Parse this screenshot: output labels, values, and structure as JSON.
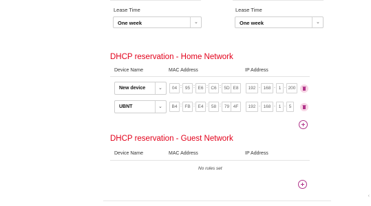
{
  "lease": {
    "left": {
      "label": "Lease Time",
      "value": "One week"
    },
    "right": {
      "label": "Lease Time",
      "value": "One week"
    }
  },
  "home": {
    "title": "DHCP reservation - Home Network",
    "headers": {
      "device": "Device Name",
      "mac": "MAC Address",
      "ip": "IP Address"
    },
    "rows": [
      {
        "device": "New device",
        "mac": [
          "04",
          "95",
          "E6",
          "C6",
          "5D",
          "E8"
        ],
        "ip": [
          "192",
          "168",
          "1",
          "200"
        ]
      },
      {
        "device": "UBNT",
        "mac": [
          "B4",
          "FB",
          "E4",
          "58",
          "79",
          "4F"
        ],
        "ip": [
          "192",
          "168",
          "1",
          "5"
        ]
      }
    ]
  },
  "guest": {
    "title": "DHCP reservation - Guest Network",
    "headers": {
      "device": "Device Name",
      "mac": "MAC Address",
      "ip": "IP Address"
    },
    "empty": "No rules set"
  },
  "icons": {
    "trash": "trash-icon",
    "add": "plus-circle-icon",
    "select": "chevron-down-icon"
  },
  "colors": {
    "accent": "#e2001a",
    "magenta": "#b0338a",
    "trash_bg": "#f7d6e5"
  }
}
